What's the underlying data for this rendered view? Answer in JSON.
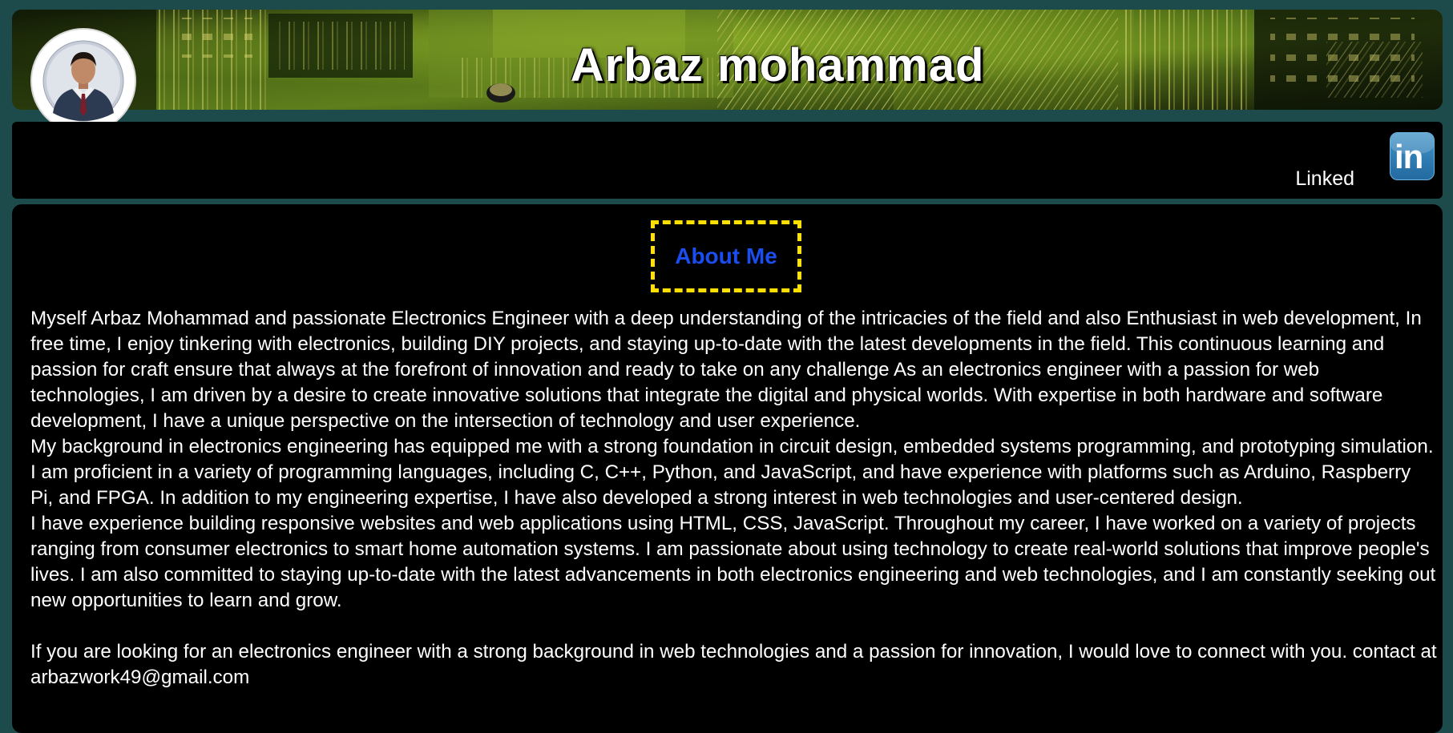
{
  "header": {
    "title": "Arbaz mohammad"
  },
  "profile": {
    "avatar_alt": "profile photo"
  },
  "nav": {
    "linkedin_label": "Linked",
    "linkedin_icon_text": "in"
  },
  "about": {
    "heading": "About Me",
    "paragraphs": [
      "Myself Arbaz Mohammad and passionate Electronics Engineer with a deep understanding of the intricacies of the field and also Enthusiast in web development, In free time, I enjoy tinkering with electronics, building DIY projects, and staying up-to-date with the latest developments in the field. This continuous learning and passion for craft ensure that always at the forefront of innovation and ready to take on any challenge As an electronics engineer with a passion for web technologies, I am driven by a desire to create innovative solutions that integrate the digital and physical worlds. With expertise in both hardware and software development, I have a unique perspective on the intersection of technology and user experience.",
      "My background in electronics engineering has equipped me with a strong foundation in circuit design, embedded systems programming, and prototyping simulation. I am proficient in a variety of programming languages, including C, C++, Python, and JavaScript, and have experience with platforms such as Arduino, Raspberry Pi, and FPGA. In addition to my engineering expertise, I have also developed a strong interest in web technologies and user-centered design.",
      "I have experience building responsive websites and web applications using HTML, CSS, JavaScript. Throughout my career, I have worked on a variety of projects ranging from consumer electronics to smart home automation systems. I am passionate about using technology to create real-world solutions that improve people's lives. I am also committed to staying up-to-date with the latest advancements in both electronics engineering and web technologies, and I am constantly seeking out new opportunities to learn and grow.",
      "If you are looking for an electronics engineer with a strong background in web technologies and a passion for innovation, I would love to connect with you. contact at arbazwork49@gmail.com"
    ]
  },
  "colors": {
    "page_background": "#1d4a4a",
    "panel_background": "#000000",
    "heading_text": "#1a4ef0",
    "heading_border": "#ffe000",
    "body_text": "#ffffff",
    "linkedin_blue": "#2f7cb3"
  },
  "icons": {
    "header_background": "circuit-board-image",
    "social": "linkedin-icon"
  }
}
